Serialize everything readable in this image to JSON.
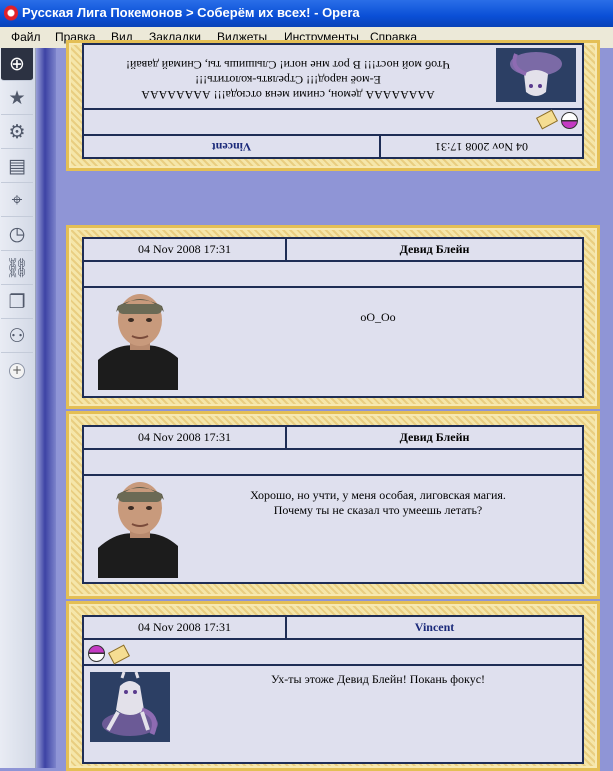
{
  "window": {
    "title": "Русская Лига Покемонов > Соберём их всех! - Opera"
  },
  "menu": [
    "Файл",
    "Правка",
    "Вид",
    "Закладки",
    "Виджеты",
    "Инструменты",
    "Справка"
  ],
  "sidebar": {
    "buttons": [
      "plus-circle-icon",
      "star-icon",
      "gear-icon",
      "chat-icon",
      "satellite-icon",
      "clock-icon",
      "link-icon",
      "pages-icon",
      "robot-icon"
    ],
    "add_label": "+"
  },
  "posts": [
    {
      "date": "04 Nov 2008 17:31",
      "author": "Vincent",
      "flipped": true,
      "message_lines": [
        "АААААААА демон, сними меня отсюда!!! АААААААА",
        "Е-моё народ!!! Стрелять-колотить!!!",
        "Чтоб мой ност!!! В рот мне ноги! Слышишь ты, Снимай давай!"
      ]
    },
    {
      "date": "04 Nov 2008 17:31",
      "author": "Девид Блейн",
      "message_lines": [
        "оО_Оо"
      ]
    },
    {
      "date": "04 Nov 2008 17:31",
      "author": "Девид Блейн",
      "message_lines": [
        "Хорошо, но учти, у меня особая, лиговская магия.",
        "Почему ты не сказал что умеешь летать?"
      ]
    },
    {
      "date": "04 Nov 2008 17:31",
      "author": "Vincent",
      "message_lines": [
        "Ух-ты этоже Девид Блейн! Покань фокус!"
      ]
    }
  ]
}
